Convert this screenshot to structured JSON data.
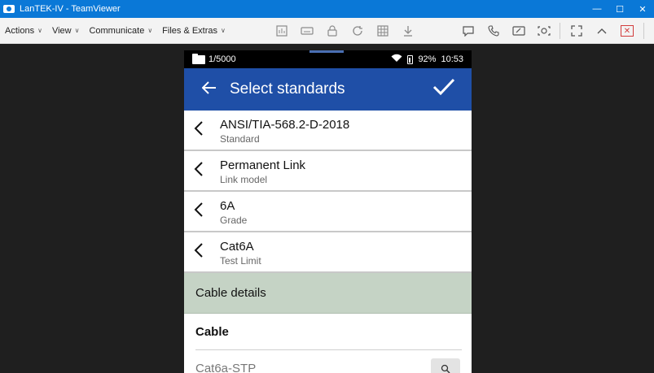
{
  "window": {
    "title": "LanTEK-IV - TeamViewer",
    "controls": [
      "—",
      "☐",
      "✕"
    ]
  },
  "menu": {
    "items": [
      {
        "label": "Actions"
      },
      {
        "label": "View"
      },
      {
        "label": "Communicate"
      },
      {
        "label": "Files & Extras"
      }
    ]
  },
  "toolbar": {
    "icons": [
      "chart-icon",
      "keyboard-icon",
      "lock-icon",
      "refresh-icon",
      "pattern-icon",
      "download-icon"
    ],
    "right_icons": [
      "chat-icon",
      "phone-icon",
      "whiteboard-icon",
      "camera-icon",
      "fullscreen-icon",
      "collapse-icon",
      "disconnect-icon"
    ]
  },
  "device": {
    "status": {
      "counter": "1/5000",
      "battery": "92%",
      "time": "10:53"
    },
    "appbar": {
      "title": "Select standards"
    },
    "rows": [
      {
        "main": "ANSI/TIA-568.2-D-2018",
        "sub": "Standard"
      },
      {
        "main": "Permanent Link",
        "sub": "Link model"
      },
      {
        "main": "6A",
        "sub": "Grade"
      },
      {
        "main": "Cat6A",
        "sub": "Test Limit"
      }
    ],
    "section_label": "Cable details",
    "cable": {
      "header": "Cable",
      "value": "Cat6a-STP"
    }
  }
}
